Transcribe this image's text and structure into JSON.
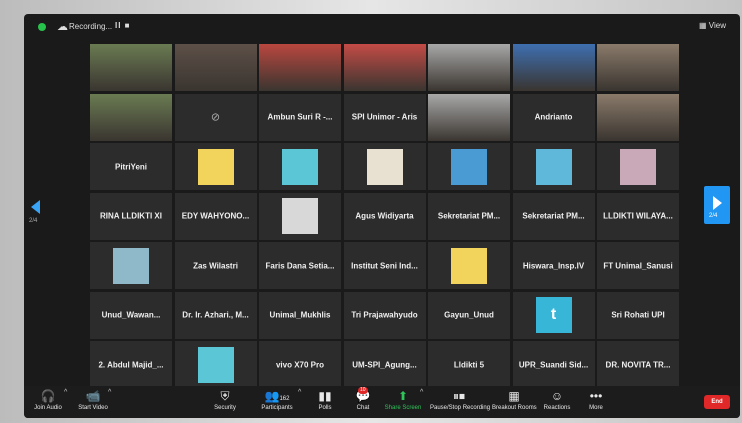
{
  "topbar": {
    "recording_label": "Recording...",
    "pause_stop": "II ■",
    "view_label": "View"
  },
  "grid": {
    "rows": [
      [
        {
          "kind": "video",
          "label": ""
        },
        {
          "kind": "video",
          "label": ""
        },
        {
          "kind": "video",
          "label": ""
        },
        {
          "kind": "video",
          "label": ""
        },
        {
          "kind": "video",
          "label": ""
        },
        {
          "kind": "video",
          "label": ""
        },
        {
          "kind": "video",
          "label": ""
        }
      ],
      [
        {
          "kind": "video",
          "label": ""
        },
        {
          "kind": "camoff",
          "label": ""
        },
        {
          "kind": "name",
          "label": "Ambun Suri R -..."
        },
        {
          "kind": "name",
          "label": "SPI Unimor - Aris"
        },
        {
          "kind": "video",
          "label": ""
        },
        {
          "kind": "name",
          "label": "Andrianto"
        },
        {
          "kind": "video",
          "label": ""
        }
      ],
      [
        {
          "kind": "name",
          "label": "PitriYeni"
        },
        {
          "kind": "thumb",
          "label": ""
        },
        {
          "kind": "thumb",
          "label": ""
        },
        {
          "kind": "thumb",
          "label": ""
        },
        {
          "kind": "thumb",
          "label": ""
        },
        {
          "kind": "thumb",
          "label": ""
        },
        {
          "kind": "thumb",
          "label": ""
        }
      ],
      [
        {
          "kind": "name",
          "label": "RINA LLDIKTI XI"
        },
        {
          "kind": "name",
          "label": "EDY WAHYONO..."
        },
        {
          "kind": "thumb",
          "label": ""
        },
        {
          "kind": "name",
          "label": "Agus Widiyarta"
        },
        {
          "kind": "name",
          "label": "Sekretariat PM..."
        },
        {
          "kind": "name",
          "label": "Sekretariat PM..."
        },
        {
          "kind": "name",
          "label": "LLDIKTI WILAYA..."
        }
      ],
      [
        {
          "kind": "thumb",
          "label": ""
        },
        {
          "kind": "name",
          "label": "Zas Wilastri"
        },
        {
          "kind": "name",
          "label": "Faris Dana Setia..."
        },
        {
          "kind": "name",
          "label": "Institut Seni Ind..."
        },
        {
          "kind": "thumb",
          "label": ""
        },
        {
          "kind": "name",
          "label": "Hiswara_Insp.IV"
        },
        {
          "kind": "name",
          "label": "FT Unimal_Sanusi"
        }
      ],
      [
        {
          "kind": "name",
          "label": "Unud_Wawan..."
        },
        {
          "kind": "name",
          "label": "Dr. Ir. Azhari., M..."
        },
        {
          "kind": "name",
          "label": "Unimal_Mukhlis"
        },
        {
          "kind": "name",
          "label": "Tri Prajawahyudo"
        },
        {
          "kind": "name",
          "label": "Gayun_Unud"
        },
        {
          "kind": "letter",
          "label": "t"
        },
        {
          "kind": "name",
          "label": "Sri Rohati UPI"
        }
      ],
      [
        {
          "kind": "name",
          "label": "2. Abdul Majid_..."
        },
        {
          "kind": "thumb",
          "label": ""
        },
        {
          "kind": "name",
          "label": "vivo X70 Pro"
        },
        {
          "kind": "name",
          "label": "UM-SPI_Agung..."
        },
        {
          "kind": "name",
          "label": "Lldikti 5"
        },
        {
          "kind": "name",
          "label": "UPR_Suandi Sid..."
        },
        {
          "kind": "name",
          "label": "DR. NOVITA TR..."
        }
      ]
    ]
  },
  "nav": {
    "left_page": "2/4",
    "right_page": "2/4"
  },
  "toolbar": {
    "join_audio": "Join Audio",
    "start_video": "Start Video",
    "security": "Security",
    "participants": "Participants",
    "participants_count": "162",
    "polls": "Polls",
    "chat": "Chat",
    "chat_badge": "10",
    "share_screen": "Share Screen",
    "pause_recording": "Pause/Stop Recording",
    "breakout_rooms": "Breakout Rooms",
    "reactions": "Reactions",
    "more": "More",
    "end": "End"
  },
  "colors": {
    "accent_blue": "#2196f3",
    "share_green": "#2fc35a",
    "end_red": "#e02828",
    "tile_bg": "#2c2c2c"
  }
}
